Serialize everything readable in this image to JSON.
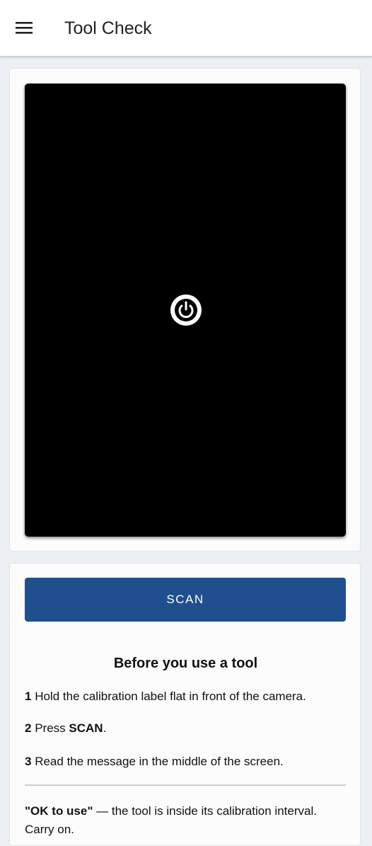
{
  "appbar": {
    "title": "Tool Check",
    "menu_icon": "hamburger-menu-icon"
  },
  "camera": {
    "power_icon": "power-icon",
    "viewport_color": "#000000"
  },
  "scan": {
    "label": "SCAN",
    "color": "#1f4f8e"
  },
  "instructions": {
    "title": "Before you use a tool",
    "steps": [
      {
        "number": "1",
        "text": "Hold the calibration label flat in front of the camera."
      },
      {
        "number": "2",
        "text_before": "Press ",
        "bold": "SCAN",
        "text_after": "."
      },
      {
        "number": "3",
        "text": "Read the message in the middle of the screen."
      }
    ],
    "note": {
      "bold": "\"OK to use\"",
      "text": " — the tool is inside its calibration interval. Carry on."
    }
  }
}
